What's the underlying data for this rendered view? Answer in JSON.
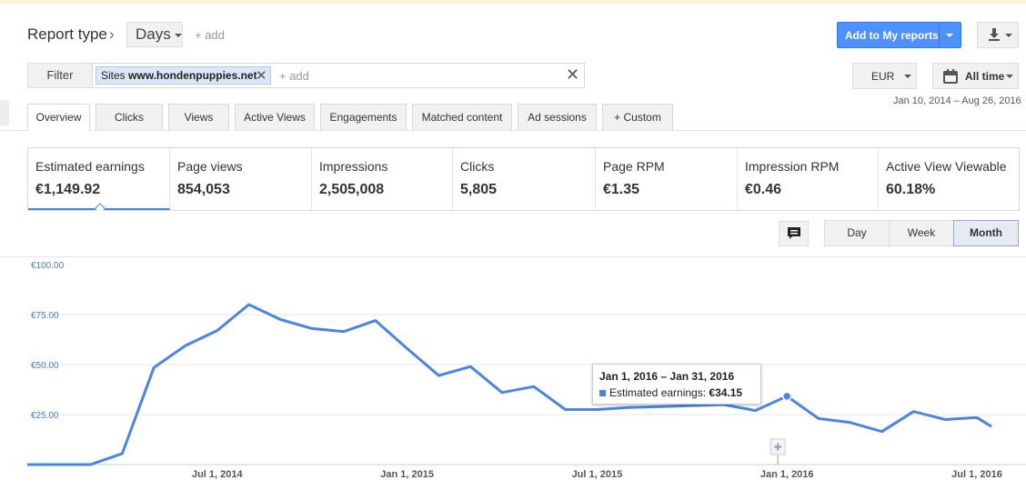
{
  "header": {
    "report_type": "Report type",
    "breadcrumb_sep": "›",
    "dimension": "Days",
    "add": "+ add",
    "add_reports_label": "Add to My reports"
  },
  "filter": {
    "label": "Filter",
    "chip_prefix": "Sites",
    "chip_value": "www.hondenpuppies.net",
    "chip_remove": "✕",
    "add": "+ add",
    "clear": "✕"
  },
  "currency": "EUR",
  "time_range": {
    "label": "All time",
    "range": "Jan 10, 2014 – Aug 26, 2016"
  },
  "tabs": [
    {
      "label": "Overview"
    },
    {
      "label": "Clicks"
    },
    {
      "label": "Views"
    },
    {
      "label": "Active Views"
    },
    {
      "label": "Engagements"
    },
    {
      "label": "Matched content"
    },
    {
      "label": "Ad sessions"
    },
    {
      "label": "+  Custom"
    }
  ],
  "metrics": [
    {
      "label": "Estimated earnings",
      "value": "€1,149.92"
    },
    {
      "label": "Page views",
      "value": "854,053"
    },
    {
      "label": "Impressions",
      "value": "2,505,008"
    },
    {
      "label": "Clicks",
      "value": "5,805"
    },
    {
      "label": "Page RPM",
      "value": "€1.35"
    },
    {
      "label": "Impression RPM",
      "value": "€0.46"
    },
    {
      "label": "Active View Viewable",
      "value": "60.18%"
    }
  ],
  "granularity": [
    {
      "label": "Day"
    },
    {
      "label": "Week"
    },
    {
      "label": "Month",
      "selected": true
    }
  ],
  "tooltip": {
    "title": "Jan 1, 2016 – Jan 31, 2016",
    "series_label": "Estimated earnings:",
    "value": "€34.15"
  },
  "colors": {
    "accent": "#4285f4",
    "line": "#4a86e0",
    "button_primary": "#4d90fe"
  },
  "chart_data": {
    "type": "line",
    "series": [
      {
        "name": "Estimated earnings",
        "x": [
          "2014-01-01",
          "2014-02-01",
          "2014-03-01",
          "2014-04-01",
          "2014-05-01",
          "2014-06-01",
          "2014-07-01",
          "2014-08-01",
          "2014-09-01",
          "2014-10-01",
          "2014-11-01",
          "2014-12-01",
          "2015-01-01",
          "2015-02-01",
          "2015-03-01",
          "2015-04-01",
          "2015-05-01",
          "2015-06-01",
          "2015-07-01",
          "2015-08-01",
          "2015-09-01",
          "2015-10-01",
          "2015-11-01",
          "2015-12-01",
          "2016-01-01",
          "2016-02-01",
          "2016-03-01",
          "2016-04-01",
          "2016-05-01",
          "2016-06-01",
          "2016-07-01",
          "2016-08-01"
        ],
        "values": [
          0,
          0,
          0,
          5.5,
          48.5,
          59.5,
          67,
          80,
          72.5,
          68,
          66.5,
          72,
          58,
          44.5,
          49,
          36,
          39,
          27.5,
          27.5,
          28.5,
          29,
          29.5,
          30,
          27,
          34.15,
          23,
          21,
          16.5,
          26.5,
          22.5,
          23.5,
          19
        ]
      }
    ],
    "ylim": [
      0,
      100
    ],
    "yticks": [
      {
        "value": 100,
        "label": "€100.00"
      },
      {
        "value": 75,
        "label": "€75.00"
      },
      {
        "value": 50,
        "label": "€50.00"
      },
      {
        "value": 25,
        "label": "€25.00"
      }
    ],
    "xticks": [
      {
        "date": "2014-07-01",
        "label": "Jul 1, 2014"
      },
      {
        "date": "2015-01-01",
        "label": "Jan 1, 2015"
      },
      {
        "date": "2015-07-01",
        "label": "Jul 1, 2015"
      },
      {
        "date": "2016-01-01",
        "label": "Jan 1, 2016"
      },
      {
        "date": "2016-07-01",
        "label": "Jul 1, 2016"
      }
    ],
    "highlight_date": "2016-01-01",
    "annotation_date": "2016-01-01",
    "grid": true
  }
}
